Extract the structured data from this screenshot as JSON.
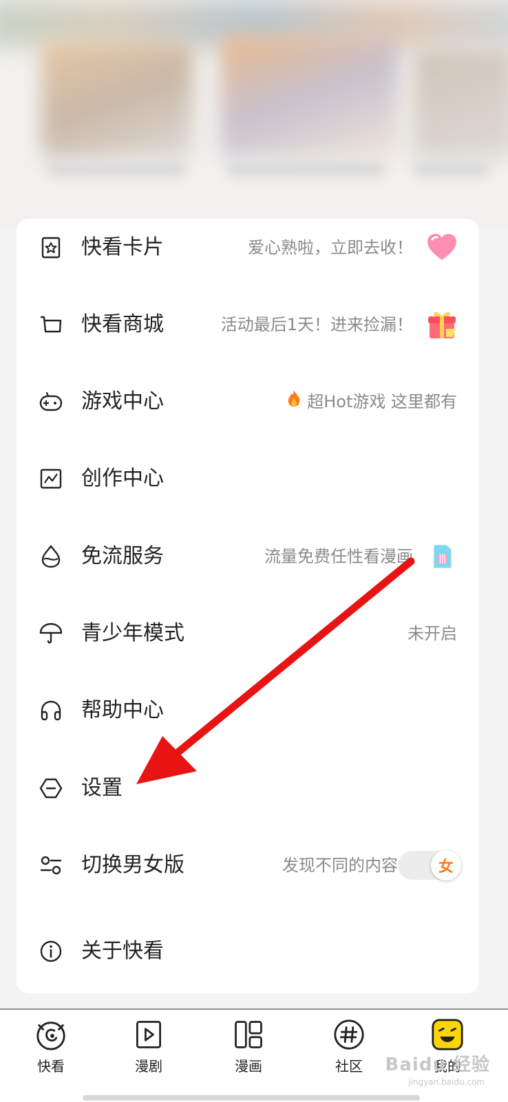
{
  "menu": {
    "items": [
      {
        "label": "快看卡片",
        "hint": "爱心熟啦，立即去收！",
        "icon": "card-star-icon",
        "badge": "heart-icon"
      },
      {
        "label": "快看商城",
        "hint": "活动最后1天！进来捡漏！",
        "icon": "cart-icon",
        "badge": "gift-icon"
      },
      {
        "label": "游戏中心",
        "hint": "超Hot游戏 这里都有",
        "icon": "gamepad-icon",
        "badge": "fire-icon"
      },
      {
        "label": "创作中心",
        "hint": "",
        "icon": "chart-icon"
      },
      {
        "label": "免流服务",
        "hint": "流量免费任性看漫画",
        "icon": "water-drop-icon",
        "badge": "sim-card-icon"
      },
      {
        "label": "青少年模式",
        "hint": "未开启",
        "icon": "umbrella-icon"
      },
      {
        "label": "帮助中心",
        "hint": "",
        "icon": "headphones-icon"
      },
      {
        "label": "设置",
        "hint": "",
        "icon": "settings-hexagon-icon"
      },
      {
        "label": "切换男女版",
        "hint": "发现不同的内容",
        "icon": "switch-icon",
        "toggle_label": "女"
      },
      {
        "label": "关于快看",
        "hint": "",
        "icon": "info-icon"
      }
    ]
  },
  "nav": {
    "items": [
      {
        "label": "快看",
        "icon": "kuaikan-eye-icon"
      },
      {
        "label": "漫剧",
        "icon": "play-icon"
      },
      {
        "label": "漫画",
        "icon": "comic-panels-icon"
      },
      {
        "label": "社区",
        "icon": "hashtag-icon"
      },
      {
        "label": "我的",
        "icon": "face-avatar-icon"
      }
    ]
  },
  "watermark": {
    "text": "Baidu 经验",
    "sub": "jingyan.baidu.com"
  },
  "colors": {
    "accent": "#ff7a1a",
    "arrow": "#e81414",
    "badge_yellow": "#ffd600"
  }
}
